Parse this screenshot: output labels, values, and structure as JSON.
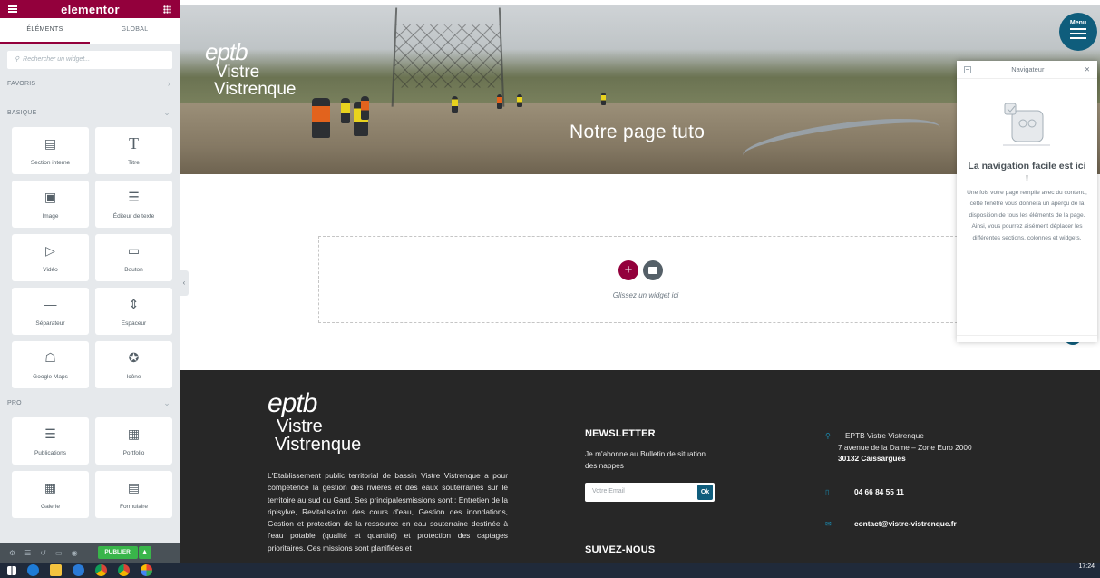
{
  "sidebar": {
    "brand": "elementor",
    "tabs": [
      "ÉLÉMENTS",
      "GLOBAL"
    ],
    "search_placeholder": "Rechercher un widget...",
    "sections": {
      "favoris": "FAVORIS",
      "basique": "BASIQUE",
      "pro": "PRO"
    },
    "basic_widgets": [
      {
        "label": "Section interne",
        "icon": "columns-icon"
      },
      {
        "label": "Titre",
        "icon": "heading-icon"
      },
      {
        "label": "Image",
        "icon": "image-icon"
      },
      {
        "label": "Éditeur de texte",
        "icon": "text-editor-icon"
      },
      {
        "label": "Vidéo",
        "icon": "video-icon"
      },
      {
        "label": "Bouton",
        "icon": "button-icon"
      },
      {
        "label": "Séparateur",
        "icon": "divider-icon"
      },
      {
        "label": "Espaceur",
        "icon": "spacer-icon"
      },
      {
        "label": "Google Maps",
        "icon": "map-icon"
      },
      {
        "label": "Icône",
        "icon": "star-icon"
      }
    ],
    "pro_widgets": [
      {
        "label": "Publications",
        "icon": "posts-icon"
      },
      {
        "label": "Portfolio",
        "icon": "portfolio-icon"
      },
      {
        "label": "Galerie",
        "icon": "gallery-icon"
      },
      {
        "label": "Formulaire",
        "icon": "form-icon"
      }
    ],
    "publish_label": "PUBLIER"
  },
  "hero": {
    "logo": {
      "eptb": "eptb",
      "line1": "Vistre",
      "line2": "Vistrenque"
    },
    "title": "Notre page tuto",
    "menu_label": "Menu"
  },
  "dropzone": {
    "text": "Glissez un widget ici"
  },
  "footer": {
    "logo": {
      "eptb": "eptb",
      "line1": "Vistre",
      "line2": "Vistrenque"
    },
    "description": "L'Etablissement public territorial de bassin Vistre Vistrenque a pour compétence la gestion des rivières et des eaux souterraines sur le territoire au sud du Gard. Ses principalesmissions sont : Entretien de la ripisylve, Revitalisation des cours d'eau, Gestion des inondations, Gestion et protection de la ressource en eau souterraine destinée à l'eau potable (qualité et quantité) et protection des captages prioritaires. Ces missions sont planifiées et",
    "newsletter": {
      "heading": "NEWSLETTER",
      "text": "Je m'abonne au Bulletin de situation des nappes",
      "placeholder": "Votre Email",
      "ok": "Ok"
    },
    "follow_heading": "SUIVEZ-NOUS",
    "contact": {
      "name": "EPTB Vistre Vistrenque",
      "address": "7 avenue de la Dame – Zone Euro 2000",
      "city": "30132 Caissargues",
      "phone": "04 66 84 55 11",
      "email": "contact@vistre-vistrenque.fr"
    }
  },
  "navigator": {
    "title": "Navigateur",
    "heading": "La navigation facile est ici !",
    "description": "Une fois votre page remplie avec du contenu, cette fenêtre vous donnera un aperçu de la disposition de tous les éléments de la page. Ainsi, vous pourrez aisément déplacer les différentes sections, colonnes et widgets."
  },
  "taskbar": {
    "time": "17:24"
  },
  "colors": {
    "elementor": "#93003c",
    "publish": "#39b54a",
    "brand_blue": "#0f5d7c",
    "footer_bg": "#272727"
  }
}
